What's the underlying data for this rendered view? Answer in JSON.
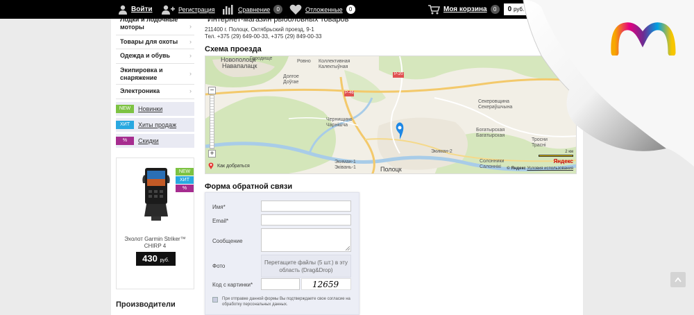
{
  "topbar": {
    "login": "Войти",
    "register": "Регистрация",
    "compare": "Сравнение",
    "compare_count": "0",
    "wishlist": "Отложенные",
    "wishlist_count": "0",
    "cart": "Моя корзина",
    "cart_count": "0",
    "cart_total": "0",
    "currency": "руб."
  },
  "sidebar": {
    "categories": [
      "Лодки и лодочные моторы",
      "Товары для охоты",
      "Одежда и обувь",
      "Экипировка и снаряжение",
      "Электроника"
    ],
    "promos": [
      {
        "tag": "NEW",
        "label": "Новинки",
        "color": "#7dc242"
      },
      {
        "tag": "ХИТ",
        "label": "Хиты продаж",
        "color": "#29a8e0"
      },
      {
        "tag": "%",
        "label": "Скидки",
        "color": "#a62c8f"
      }
    ]
  },
  "product": {
    "tags": [
      "NEW",
      "ХИТ",
      "%"
    ],
    "name": "Эхолот Garmin Striker™ CHIRP 4",
    "price": "430",
    "currency": "руб."
  },
  "manufacturers_heading": "Производители",
  "shop": {
    "title": "\"Интернет-магазин рыболовных товаров\"",
    "address": "211400 г. Полоцк, Октябрьский проезд, 9-1",
    "phones": "Тел. +375 (29) 649-00-33, +375 (29) 849-00-33"
  },
  "map": {
    "heading": "Схема проезда",
    "directions": "Как добраться",
    "brand": "Яндекс",
    "copyright": "© Яндекс",
    "terms": "Условия использования",
    "scale": "2 км",
    "zoom_in": "+",
    "zoom_out": "−",
    "places": {
      "novopolotsk": "Новополоцк",
      "navapolatsk": "Навапалацк",
      "polotsk": "Полоцк",
      "ekiman1": "Экиман-1",
      "ekiman1b": "Эківань-1",
      "chernishchino": "Чернищино",
      "chernishcha": "Чарнішча",
      "sekerovshchina": "Секеровщина",
      "sekerovshchina2": "Секераўшчына",
      "bogatyrskaya": "Богатырская",
      "bogatyrskaya2": "Багатырская",
      "solonniki": "Солонники",
      "solonniki2": "Салоннікі",
      "ekiman2": "Экиман-2",
      "trosnitsa": "Тросни",
      "trosnitsa2": "Трасні",
      "gorodishche": "Городище",
      "rovno": "Ровно",
      "kollektivnaya": "Коллективная",
      "kalektyunaya": "Калектыўная",
      "dolgoe": "Долгое",
      "dougae": "Доўгае",
      "p20": "Р-20",
      "p46": "Р-46"
    }
  },
  "form": {
    "heading": "Форма обратной связи",
    "name_label": "Имя*",
    "email_label": "Email*",
    "message_label": "Сообщение",
    "photo_label": "Фото",
    "dropzone_text": "Перетащите файлы (5 шт.) в эту область (Drag&Drop)",
    "captcha_label": "Код с картинки*",
    "captcha_value": "12659",
    "consent": "При отправке данной формы Вы подтверждаете свое согласие на обработку персональных данных."
  },
  "colors": {
    "topbar": "#000000",
    "new": "#7dc242",
    "hit": "#29a8e0",
    "sale": "#a62c8f"
  }
}
